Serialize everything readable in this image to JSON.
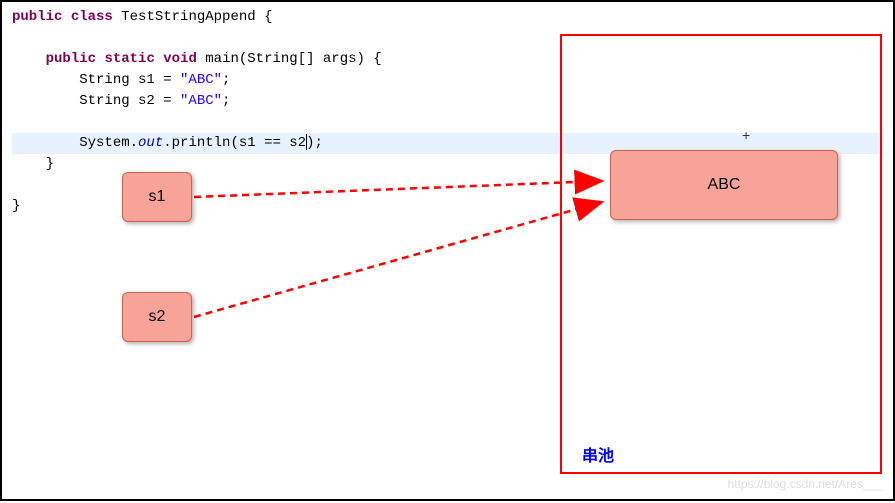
{
  "code": {
    "line1_kw1": "public",
    "line1_kw2": "class",
    "line1_rest": " TestStringAppend {",
    "line2": "",
    "line3_kw1": "public",
    "line3_kw2": "static",
    "line3_kw3": "void",
    "line3_rest1": " main(String[] args) {",
    "line4_pre": "        String s1 = ",
    "line4_str": "\"ABC\"",
    "line4_post": ";",
    "line5_pre": "        String s2 = ",
    "line5_str": "\"ABC\"",
    "line5_post": ";",
    "line6": "",
    "line7_pre": "        System.",
    "line7_out": "out",
    "line7_post": ".println(s1 == s2);",
    "line8": "    }",
    "line9": "",
    "line10": "}"
  },
  "diagram": {
    "s1_label": "s1",
    "s2_label": "s2",
    "abc_label": "ABC",
    "pool_label": "串池",
    "plus": "+"
  },
  "watermark": "https://blog.csdn.net/Ares___"
}
